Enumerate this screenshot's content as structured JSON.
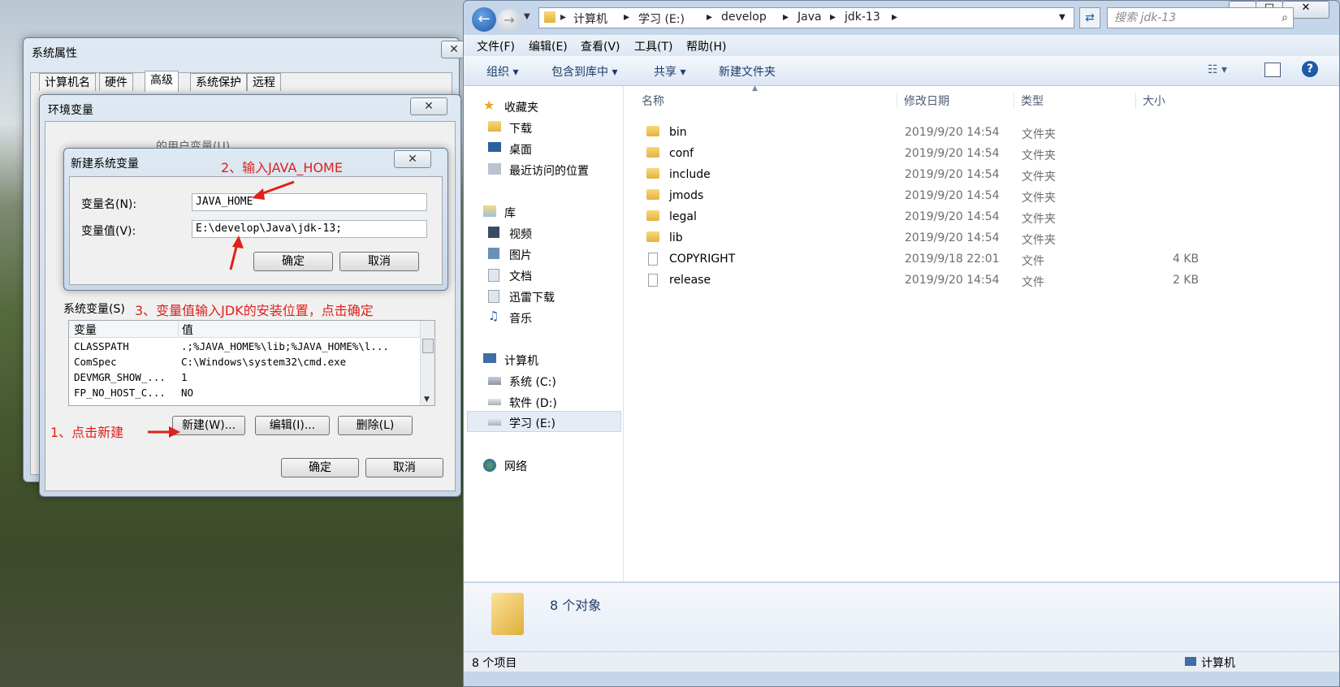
{
  "sysprops": {
    "title": "系统属性",
    "close": "✕",
    "tabs": [
      "计算机名",
      "硬件",
      "高级",
      "系统保护",
      "远程"
    ]
  },
  "envvars": {
    "title": "环境变量",
    "close": "✕",
    "user_section": "的用户变量(U)",
    "system_section": "系统变量(S)",
    "col_var": "变量",
    "col_val": "值",
    "rows": [
      {
        "name": "CLASSPATH",
        "value": ".;%JAVA_HOME%\\lib;%JAVA_HOME%\\l..."
      },
      {
        "name": "ComSpec",
        "value": "C:\\Windows\\system32\\cmd.exe"
      },
      {
        "name": "DEVMGR_SHOW_...",
        "value": "1"
      },
      {
        "name": "FP_NO_HOST_C...",
        "value": "NO"
      }
    ],
    "new_btn": "新建(W)...",
    "edit_btn": "编辑(I)...",
    "delete_btn": "删除(L)",
    "ok_btn": "确定",
    "cancel_btn": "取消"
  },
  "newvar": {
    "title": "新建系统变量",
    "close": "✕",
    "name_label": "变量名(N):",
    "name_value": "JAVA_HOME",
    "value_label": "变量值(V):",
    "value_value": "E:\\develop\\Java\\jdk-13;",
    "ok_btn": "确定",
    "cancel_btn": "取消"
  },
  "annotations": {
    "step1": "1、点击新建",
    "step2": "2、输入JAVA_HOME",
    "step3": "3、变量值输入JDK的安装位置，点击确定"
  },
  "explorer": {
    "window_buttons": [
      "▁",
      "□",
      "✕"
    ],
    "breadcrumb": [
      "计算机",
      "学习 (E:)",
      "develop",
      "Java",
      "jdk-13"
    ],
    "search_placeholder": "搜索 jdk-13",
    "menu": [
      "文件(F)",
      "编辑(E)",
      "查看(V)",
      "工具(T)",
      "帮助(H)"
    ],
    "toolbar": [
      "组织 ▾",
      "包含到库中 ▾",
      "共享 ▾",
      "新建文件夹"
    ],
    "nav": {
      "favorites": "收藏夹",
      "fav_items": [
        "下载",
        "桌面",
        "最近访问的位置"
      ],
      "libraries": "库",
      "lib_items": [
        "视频",
        "图片",
        "文档",
        "迅雷下载",
        "音乐"
      ],
      "computer": "计算机",
      "drives": [
        "系统 (C:)",
        "软件 (D:)",
        "学习 (E:)"
      ],
      "network": "网络"
    },
    "columns": [
      "名称",
      "修改日期",
      "类型",
      "大小"
    ],
    "files": [
      {
        "name": "bin",
        "date": "2019/9/20 14:54",
        "type": "文件夹",
        "size": "",
        "kind": "folder"
      },
      {
        "name": "conf",
        "date": "2019/9/20 14:54",
        "type": "文件夹",
        "size": "",
        "kind": "folder"
      },
      {
        "name": "include",
        "date": "2019/9/20 14:54",
        "type": "文件夹",
        "size": "",
        "kind": "folder"
      },
      {
        "name": "jmods",
        "date": "2019/9/20 14:54",
        "type": "文件夹",
        "size": "",
        "kind": "folder"
      },
      {
        "name": "legal",
        "date": "2019/9/20 14:54",
        "type": "文件夹",
        "size": "",
        "kind": "folder"
      },
      {
        "name": "lib",
        "date": "2019/9/20 14:54",
        "type": "文件夹",
        "size": "",
        "kind": "folder"
      },
      {
        "name": "COPYRIGHT",
        "date": "2019/9/18 22:01",
        "type": "文件",
        "size": "4 KB",
        "kind": "file"
      },
      {
        "name": "release",
        "date": "2019/9/20 14:54",
        "type": "文件",
        "size": "2 KB",
        "kind": "file"
      }
    ],
    "details_text": "8 个对象",
    "status_count": "8 个项目",
    "status_location": "计算机"
  }
}
